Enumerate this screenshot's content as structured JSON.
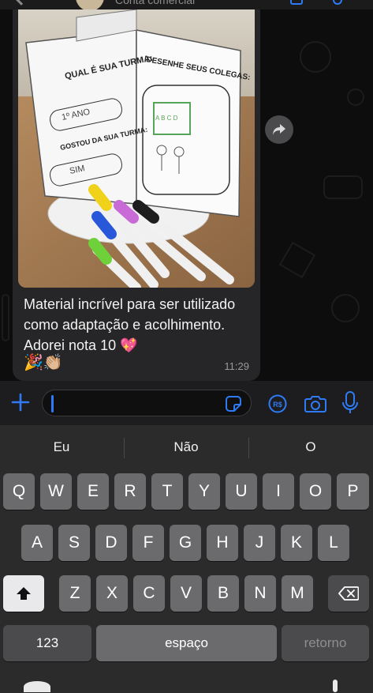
{
  "header": {
    "subtitle": "Conta comercial"
  },
  "message": {
    "caption": "Material incrível para ser utilizado como adaptação e acolhimento. Adorei nota 10 💖",
    "emojis": "🎉👏🏼",
    "time": "11:29",
    "photo": {
      "left_page_title": "QUAL É SUA TURMA:",
      "left_page_answer": "1º ANO",
      "left_page_question": "GOSTOU DA SUA TURMA:",
      "left_page_answer2": "SIM",
      "right_page_title": "DESENHE SEUS COLEGAS:",
      "drawing_label": "A B C D"
    }
  },
  "input": {
    "placeholder": ""
  },
  "keyboard": {
    "suggestions": [
      "Eu",
      "Não",
      "O"
    ],
    "row1": [
      "Q",
      "W",
      "E",
      "R",
      "T",
      "Y",
      "U",
      "I",
      "O",
      "P"
    ],
    "row2": [
      "A",
      "S",
      "D",
      "F",
      "G",
      "H",
      "J",
      "K",
      "L"
    ],
    "row3": [
      "Z",
      "X",
      "C",
      "V",
      "B",
      "N",
      "M"
    ],
    "numbers_label": "123",
    "space_label": "espaço",
    "return_label": "retorno"
  },
  "colors": {
    "accent": "#2f7bf6",
    "bubble": "#262628",
    "heart": "#e23d8f"
  }
}
